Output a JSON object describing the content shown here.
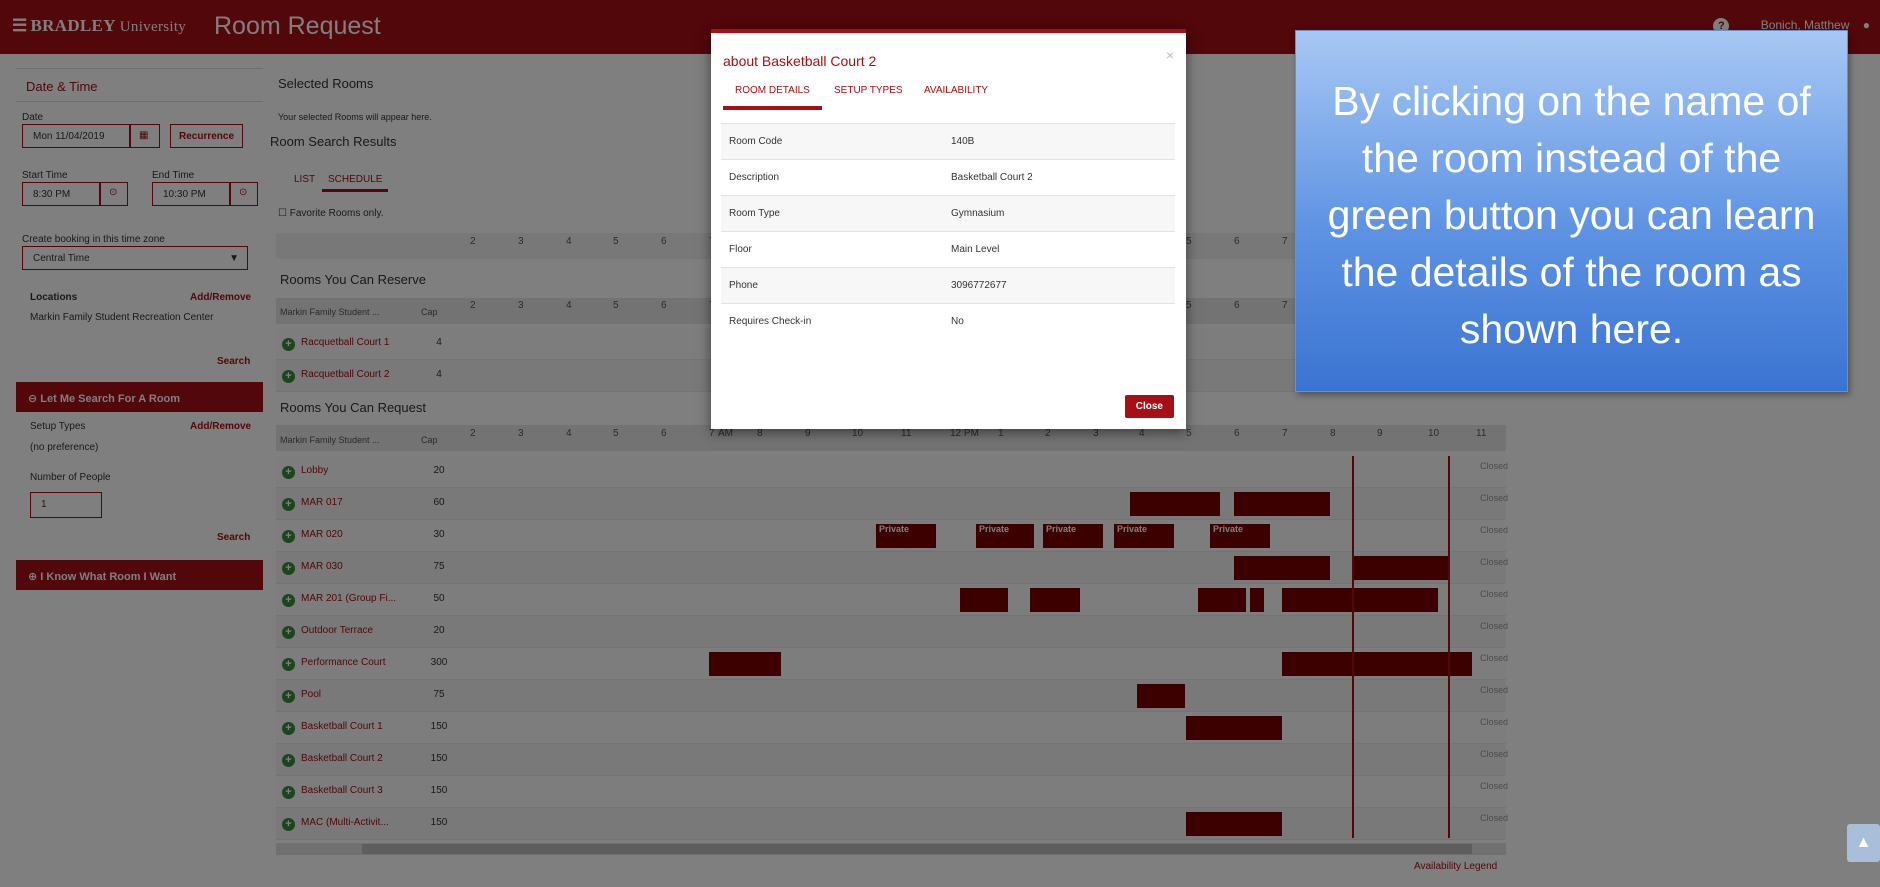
{
  "header": {
    "logo_brand": "BRADLEY",
    "logo_sub": "University",
    "app_title": "Room Request",
    "user_name": "Bonich, Matthew"
  },
  "left": {
    "date_time_title": "Date & Time",
    "date_label": "Date",
    "date_value": "Mon 11/04/2019",
    "recurrence_label": "Recurrence",
    "start_label": "Start Time",
    "start_value": "8:30 PM",
    "end_label": "End Time",
    "end_value": "10:30 PM",
    "tz_label": "Create booking in this time zone",
    "tz_value": "Central Time",
    "locations_label": "Locations",
    "add_remove_label": "Add/Remove",
    "location_value": "Markin Family Student Recreation Center",
    "search_label": "Search",
    "search_for_room_label": "Let Me Search For A Room",
    "setup_types_label": "Setup Types",
    "setup_value": "(no preference)",
    "people_label": "Number of People",
    "people_value": "1",
    "know_room_label": "I Know What Room I Want"
  },
  "main": {
    "selected_title": "Selected Rooms",
    "selected_empty": "Your selected Rooms will appear here.",
    "results_title": "Room Search Results",
    "tab_list": "LIST",
    "tab_schedule": "SCHEDULE",
    "favorites_label": "Favorite Rooms only.",
    "reserve_title": "Rooms You Can Reserve",
    "request_title": "Rooms You Can Request",
    "building_col": "Markin Family Student ...",
    "cap_col": "Cap",
    "ticks": [
      "2",
      "3",
      "4",
      "5",
      "6",
      "7",
      "AM",
      "8",
      "9",
      "10",
      "11",
      "12 PM",
      "1",
      "2",
      "3",
      "4",
      "5",
      "6",
      "7",
      "8",
      "9",
      "10",
      "11"
    ],
    "closed_label": "Closed",
    "private_label": "Private",
    "legend_label": "Availability Legend",
    "reserve_rooms": [
      {
        "name": "Racquetball Court 1",
        "cap": "4"
      },
      {
        "name": "Racquetball Court 2",
        "cap": "4"
      }
    ],
    "request_rooms": [
      {
        "name": "Lobby",
        "cap": "20"
      },
      {
        "name": "MAR 017",
        "cap": "60"
      },
      {
        "name": "MAR 020",
        "cap": "30"
      },
      {
        "name": "MAR 030",
        "cap": "75"
      },
      {
        "name": "MAR 201 (Group Fi...",
        "cap": "50"
      },
      {
        "name": "Outdoor Terrace",
        "cap": "20"
      },
      {
        "name": "Performance Court",
        "cap": "300"
      },
      {
        "name": "Pool",
        "cap": "75"
      },
      {
        "name": "Basketball Court 1",
        "cap": "150"
      },
      {
        "name": "Basketball Court 2",
        "cap": "150"
      },
      {
        "name": "Basketball Court 3",
        "cap": "150"
      },
      {
        "name": "MAC (Multi-Activit...",
        "cap": "150"
      }
    ]
  },
  "modal": {
    "title": "about Basketball Court 2",
    "tab_details": "ROOM DETAILS",
    "tab_setup": "SETUP TYPES",
    "tab_availability": "AVAILABILITY",
    "rows": [
      {
        "k": "Room Code",
        "v": "140B"
      },
      {
        "k": "Description",
        "v": "Basketball Court 2"
      },
      {
        "k": "Room Type",
        "v": "Gymnasium"
      },
      {
        "k": "Floor",
        "v": "Main Level"
      },
      {
        "k": "Phone",
        "v": "3096772677"
      },
      {
        "k": "Requires Check-in",
        "v": "No"
      }
    ],
    "close_label": "Close"
  },
  "callout": {
    "text": "By clicking on the name of the room instead of the green button you can learn the details of the room as shown here."
  },
  "colors": {
    "brand": "#a50f15",
    "booked": "#7a0000",
    "callout": "#5e93e3"
  }
}
